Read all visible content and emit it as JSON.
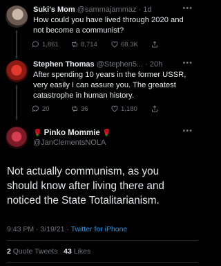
{
  "tweets": [
    {
      "name": "Suki's Mom",
      "handle": "@sammajammaz",
      "time": "· 1d",
      "text": "How could you have lived through 2020 and not become a communist?",
      "replies": "1,861",
      "retweets": "8,714",
      "likes": "68.3K"
    },
    {
      "name": "Stephen Thomas",
      "handle": "@Stephen5...",
      "time": "· 20h",
      "text": "After spending 10 years in the former USSR, very easily I can assure you. The greatest catastrophe in human history.",
      "replies": "20",
      "retweets": "36",
      "likes": "1,180"
    }
  ],
  "main": {
    "name": "Pinko Mommie",
    "handle": "@JanClementsNOLA",
    "text": "Not actually communism, as you should know after living there and noticed the State Totalitarianism.",
    "time": "9:43 PM · 3/19/21 ·",
    "source": "Twitter for iPhone",
    "quote_count": "2",
    "quote_label": "Quote Tweets",
    "like_count": "43",
    "like_label": "Likes"
  },
  "icons": [
    "reply-icon",
    "retweet-icon",
    "like-icon",
    "share-icon",
    "more-icon",
    "rose-emoji-icon"
  ],
  "colors": {
    "background": "#000000",
    "text": "#e7e9ea",
    "muted": "#71767b",
    "link": "#1d9bf0",
    "rose": "#e0245e"
  }
}
